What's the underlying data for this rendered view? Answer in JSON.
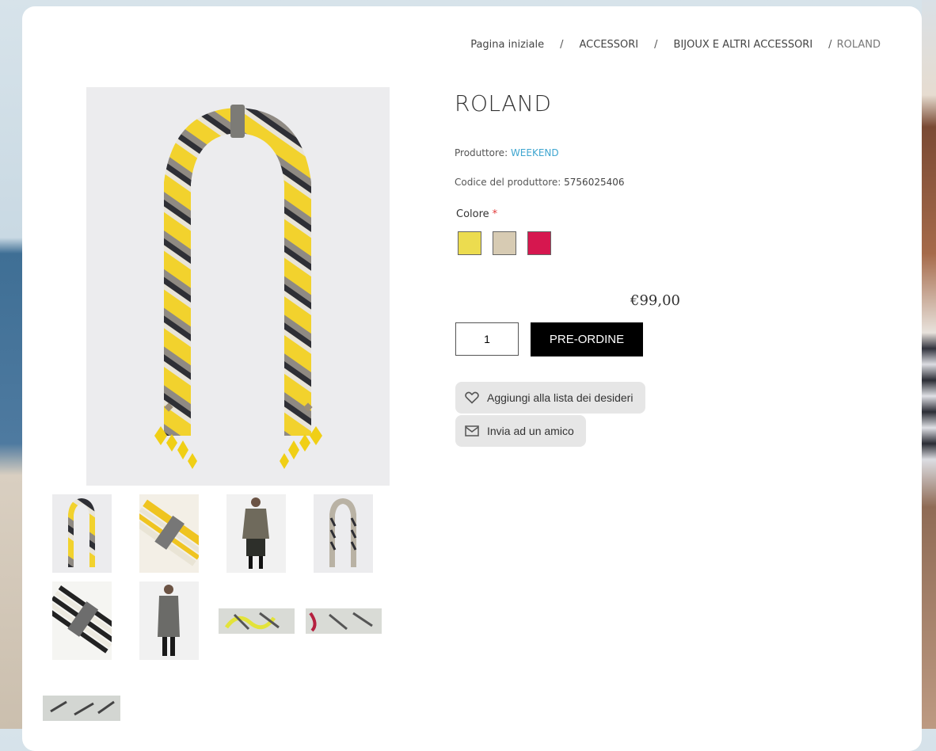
{
  "breadcrumb": {
    "home": "Pagina iniziale",
    "level1": "ACCESSORI",
    "level2": "BIJOUX E ALTRI ACCESSORI",
    "current": "ROLAND",
    "separator": "/"
  },
  "product": {
    "name": "ROLAND",
    "manufacturer_label": "Produttore:",
    "manufacturer": "WEEKEND",
    "code_label": "Codice del produttore:",
    "code": "5756025406",
    "color_label": "Colore",
    "required_mark": "*",
    "colors": [
      "#ecdc4f",
      "#d7cbb3",
      "#d6174f"
    ],
    "price": "€99,00",
    "quantity": "1",
    "preorder_label": "PRE-ORDINE",
    "wishlist_label": "Aggiungi alla lista dei desideri",
    "send_friend_label": "Invia ad un amico"
  },
  "icons": {
    "wishlist": "heart-icon",
    "send_friend": "envelope-icon"
  },
  "colors": {
    "link": "#3fa6d0",
    "required": "#e23a3a",
    "button": "#000000",
    "pill": "#e6e6e6"
  }
}
